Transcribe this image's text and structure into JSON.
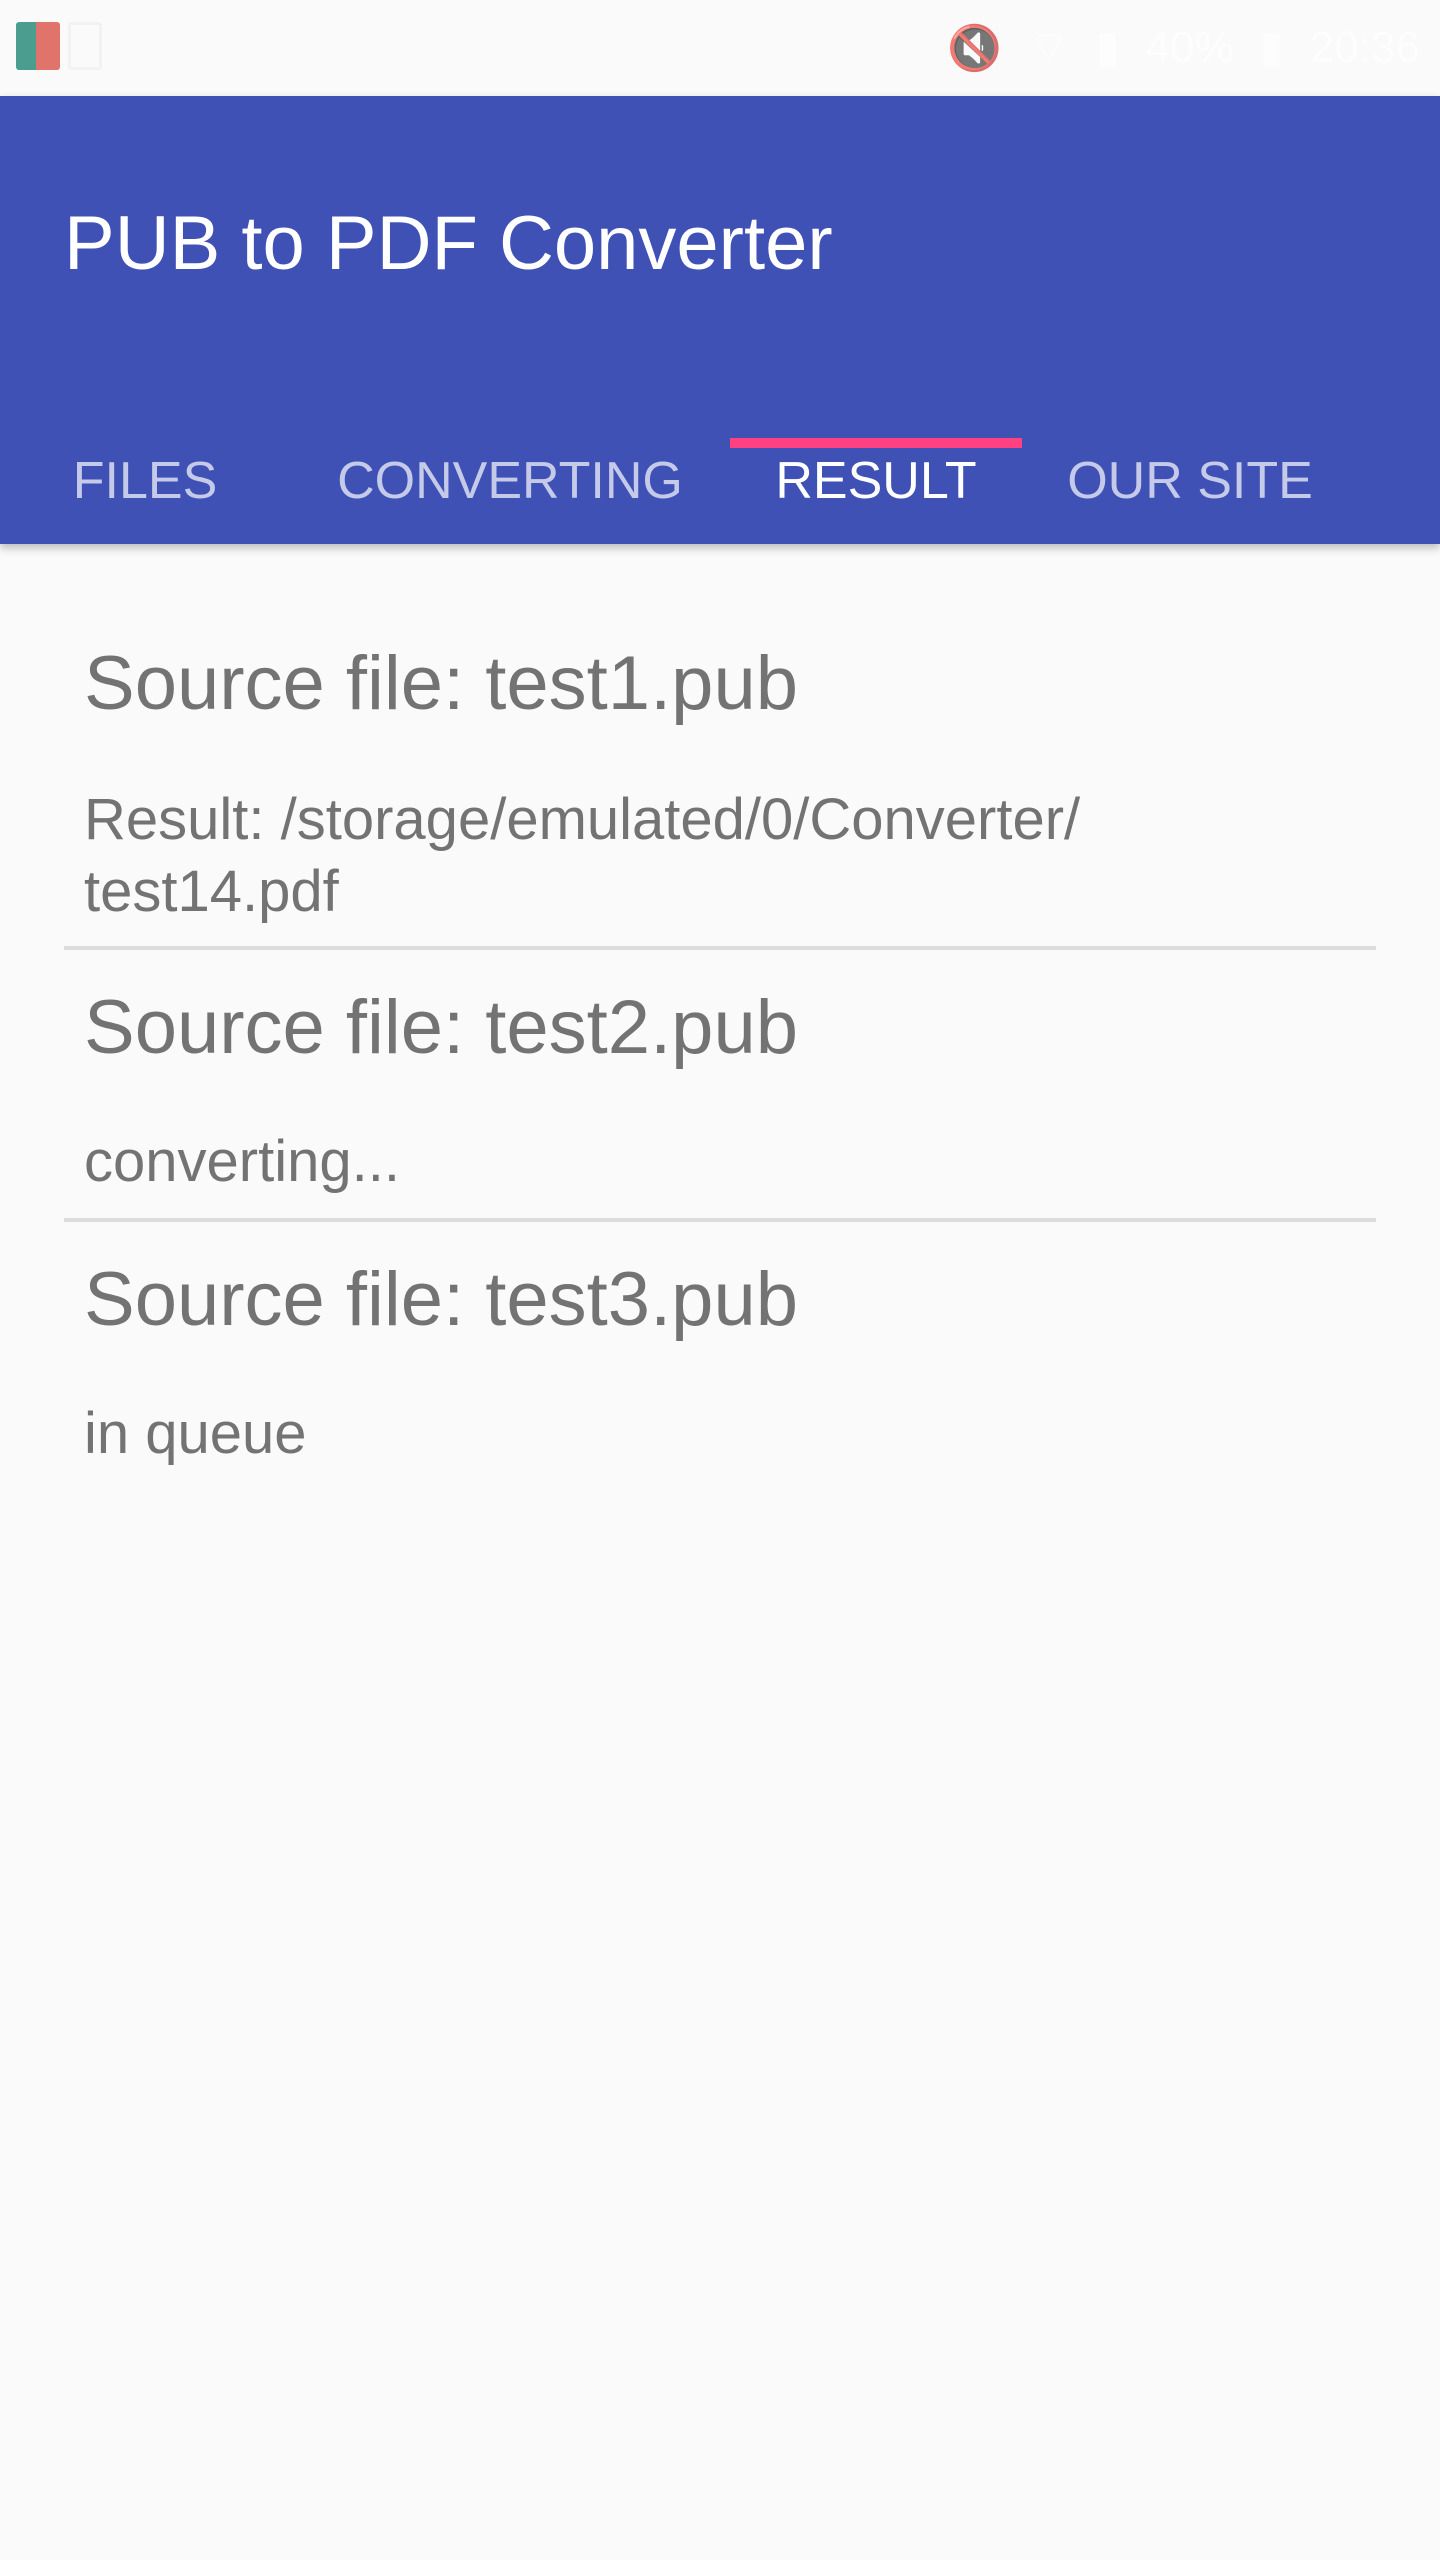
{
  "status_bar": {
    "notification_icons": [
      "converter-app-icon",
      "image-icon"
    ],
    "battery": "40%",
    "time": "20:36"
  },
  "app": {
    "title": "PUB to PDF Converter",
    "accent_color": "#3f51b5",
    "indicator_color": "#ff4081"
  },
  "tabs": [
    {
      "label": "FILES",
      "active": false
    },
    {
      "label": "CONVERTING",
      "active": false
    },
    {
      "label": "RESULT",
      "active": true
    },
    {
      "label": "OUR SITE",
      "active": false
    }
  ],
  "results": [
    {
      "source": "Source file: test1.pub",
      "status": "Result: /storage/emulated/0/Converter/ test14.pdf"
    },
    {
      "source": "Source file: test2.pub",
      "status": "converting..."
    },
    {
      "source": "Source file: test3.pub",
      "status": "in queue"
    }
  ]
}
